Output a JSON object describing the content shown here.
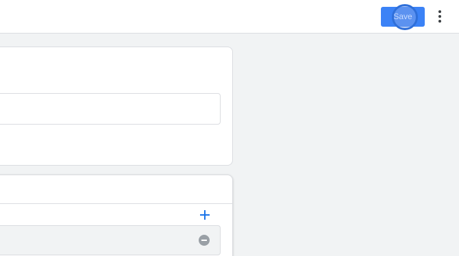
{
  "header": {
    "save_label": "Save"
  },
  "icons": {
    "more": "more-vert-icon",
    "add": "add-icon",
    "remove": "remove-circle-icon"
  },
  "form": {
    "text_input_value": ""
  },
  "colors": {
    "accent": "#3b82f6",
    "background": "#f1f3f4",
    "surface": "#ffffff",
    "border": "#dadce0",
    "add_icon": "#1a73e8",
    "remove_icon": "#9aa0a6"
  }
}
